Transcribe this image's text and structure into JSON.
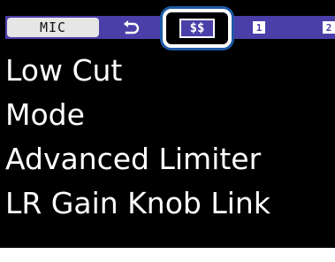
{
  "header": {
    "mic_tab_label": "MIC",
    "back_icon": "return-arrow-icon",
    "selected_tab_label": "$$",
    "track_tabs": [
      {
        "label": "1"
      },
      {
        "label": "2"
      }
    ]
  },
  "menu": {
    "items": [
      {
        "label": "Low Cut"
      },
      {
        "label": "Mode"
      },
      {
        "label": "Advanced Limiter"
      },
      {
        "label": "LR Gain Knob Link"
      }
    ]
  },
  "colors": {
    "background": "#000000",
    "tab_strip": "#4a3fa8",
    "selection_outline": "#1e5aa6",
    "text": "#ffffff"
  }
}
